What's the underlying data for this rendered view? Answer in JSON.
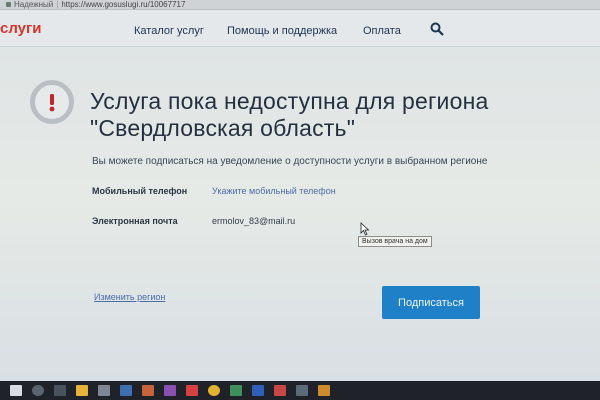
{
  "browser": {
    "secure_label": "Надежный",
    "url": "https://www.gosuslugi.ru/10067717"
  },
  "header": {
    "logo": "слуги",
    "nav": [
      "Каталог услуг",
      "Помощь и поддержка",
      "Оплата"
    ],
    "search_icon": "search-icon"
  },
  "notice": {
    "title_line1": "Услуга пока недоступна для региона",
    "title_line2": "\"Свердловская область\"",
    "subtitle": "Вы можете подписаться на уведомление о доступности услуги в выбранном регионе"
  },
  "form": {
    "phone_label": "Мобильный телефон",
    "phone_value": "Укажите мобильный телефон",
    "email_label": "Электронная почта",
    "email_value": "ermolov_83@mail.ru"
  },
  "tooltip": "Вызов врача на дом",
  "actions": {
    "change_region": "Изменить регион",
    "subscribe": "Подписаться"
  },
  "colors": {
    "accent": "#1f7fc7",
    "link": "#4a6ea8",
    "logo": "#d8342c",
    "alert": "#c0282c"
  },
  "taskbar": {
    "icons": [
      "start-icon",
      "search-icon",
      "task-view-icon",
      "explorer-icon",
      "store-icon",
      "app-icon",
      "app-icon",
      "app-icon",
      "app-icon",
      "chrome-icon",
      "app-icon",
      "word-icon",
      "app-icon",
      "app-icon",
      "app-icon"
    ]
  }
}
